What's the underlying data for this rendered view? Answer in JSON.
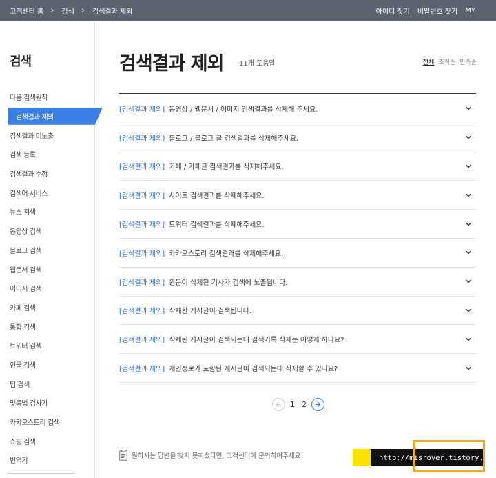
{
  "topbar": {
    "breadcrumbs": [
      "고객센터 홈",
      "검색",
      "검색결과 제외"
    ],
    "links": [
      "아이디 찾기",
      "비밀번호 찾기",
      "MY"
    ]
  },
  "sidebar": {
    "title": "검색",
    "items": [
      {
        "label": "다음 검색원칙"
      },
      {
        "label": "검색결과 제외"
      },
      {
        "label": "검색결과 미노출"
      },
      {
        "label": "검색 등록"
      },
      {
        "label": "검색결과 수정"
      },
      {
        "label": "검색어 서비스"
      },
      {
        "label": "뉴스 검색"
      },
      {
        "label": "동영상 검색"
      },
      {
        "label": "블로그 검색"
      },
      {
        "label": "웹문서 검색"
      },
      {
        "label": "이미지 검색"
      },
      {
        "label": "카페 검색"
      },
      {
        "label": "통합 검색"
      },
      {
        "label": "트위터 검색"
      },
      {
        "label": "인물 검색"
      },
      {
        "label": "팁 검색"
      },
      {
        "label": "맞춤법 검사기"
      },
      {
        "label": "카카오스토리 검색"
      },
      {
        "label": "쇼핑 검색"
      },
      {
        "label": "번역기"
      }
    ],
    "active_index": 1
  },
  "main": {
    "title": "검색결과 제외",
    "count": "11개 도움말",
    "sorts": [
      "전체",
      "조회순",
      "만족순"
    ],
    "questions": [
      {
        "category": "[검색결과 제외]",
        "text": "동영상 / 웹문서 / 이미지 검색결과를 삭제해 주세요."
      },
      {
        "category": "[검색결과 제외]",
        "text": "블로그 / 블로그 글 검색결과를 삭제해주세요."
      },
      {
        "category": "[검색결과 제외]",
        "text": "카페 / 카페글 검색결과를 삭제해주세요."
      },
      {
        "category": "[검색결과 제외]",
        "text": "사이트 검색결과를 삭제해주세요."
      },
      {
        "category": "[검색결과 제외]",
        "text": "트위터 검색결과를 삭제해주세요."
      },
      {
        "category": "[검색결과 제외]",
        "text": "카카오스토리 검색결과를 삭제해주세요."
      },
      {
        "category": "[검색결과 제외]",
        "text": "원문이 삭제된 기사가 검색에 노출됩니다."
      },
      {
        "category": "[검색결과 제외]",
        "text": "삭제한 게시글이 검색됩니다."
      },
      {
        "category": "[검색결과 제외]",
        "text": "삭제된 게시글이 검색되는데 검색기록 삭제는 어떻게 하나요?"
      },
      {
        "category": "[검색결과 제외]",
        "text": "개인정보가 포함된 게시글이 검색되는데 삭제할 수 있나요?"
      }
    ],
    "pagination": {
      "pages": [
        "1",
        "2"
      ],
      "current": "1"
    },
    "help_text": "원하시는 답변을 찾지 못하셨다면, 고객센터에 문의하여주세요",
    "watermark": "http://misrover.tistory.com"
  },
  "colors": {
    "topbar": "#5c6270",
    "accent": "#3b7fe6",
    "category": "#2f6fe0",
    "kakao": "#fae100",
    "highlight": "#f5a623"
  }
}
